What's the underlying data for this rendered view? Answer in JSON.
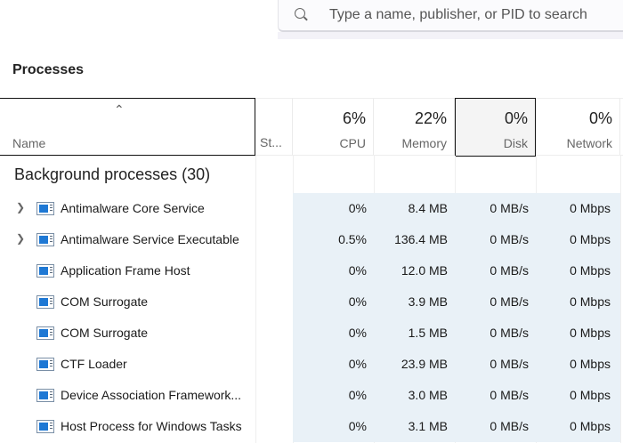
{
  "search": {
    "placeholder": "Type a name, publisher, or PID to search"
  },
  "title": "Processes",
  "columns": {
    "name": "Name",
    "status": "St...",
    "cpu": {
      "pct": "6%",
      "label": "CPU"
    },
    "memory": {
      "pct": "22%",
      "label": "Memory"
    },
    "disk": {
      "pct": "0%",
      "label": "Disk"
    },
    "network": {
      "pct": "0%",
      "label": "Network"
    }
  },
  "group": "Background processes (30)",
  "rows": [
    {
      "name": "Antimalware Core Service",
      "expand": true,
      "cpu": "0%",
      "memory": "8.4 MB",
      "disk": "0 MB/s",
      "network": "0 Mbps"
    },
    {
      "name": "Antimalware Service Executable",
      "expand": true,
      "cpu": "0.5%",
      "memory": "136.4 MB",
      "disk": "0 MB/s",
      "network": "0 Mbps"
    },
    {
      "name": "Application Frame Host",
      "expand": false,
      "cpu": "0%",
      "memory": "12.0 MB",
      "disk": "0 MB/s",
      "network": "0 Mbps"
    },
    {
      "name": "COM Surrogate",
      "expand": false,
      "cpu": "0%",
      "memory": "3.9 MB",
      "disk": "0 MB/s",
      "network": "0 Mbps"
    },
    {
      "name": "COM Surrogate",
      "expand": false,
      "cpu": "0%",
      "memory": "1.5 MB",
      "disk": "0 MB/s",
      "network": "0 Mbps"
    },
    {
      "name": "CTF Loader",
      "expand": false,
      "cpu": "0%",
      "memory": "23.9 MB",
      "disk": "0 MB/s",
      "network": "0 Mbps"
    },
    {
      "name": "Device Association Framework...",
      "expand": false,
      "cpu": "0%",
      "memory": "3.0 MB",
      "disk": "0 MB/s",
      "network": "0 Mbps"
    },
    {
      "name": "Host Process for Windows Tasks",
      "expand": false,
      "cpu": "0%",
      "memory": "3.1 MB",
      "disk": "0 MB/s",
      "network": "0 Mbps"
    }
  ]
}
